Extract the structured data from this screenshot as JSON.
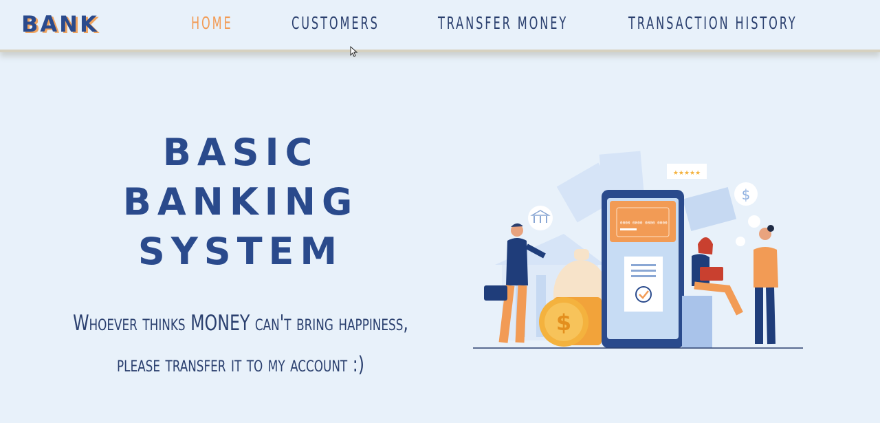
{
  "navbar": {
    "brand": "BANK",
    "links": [
      {
        "label": "HOME",
        "active": true
      },
      {
        "label": "CUSTOMERS",
        "active": false
      },
      {
        "label": "TRANSFER MONEY",
        "active": false
      },
      {
        "label": "TRANSACTION HISTORY",
        "active": false
      }
    ]
  },
  "hero": {
    "title_lines": [
      "BASIC",
      "BANKING",
      "SYSTEM"
    ],
    "quote_lines": [
      "Whoever thinks MONEY can't bring happiness,",
      "please transfer it to my account :)"
    ]
  },
  "illustration": {
    "card_number": "0000 0000 0000 0000",
    "rating": "★★★★★",
    "icons": [
      "bank-icon",
      "dollar-icon",
      "checkmark-icon"
    ]
  },
  "colors": {
    "background": "#e8f1fa",
    "primary": "#2a4a8c",
    "accent": "#f29b55"
  }
}
